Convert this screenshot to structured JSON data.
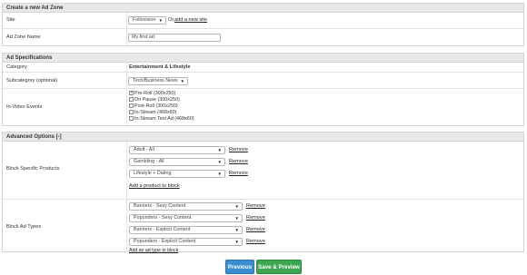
{
  "create": {
    "header": "Create a new Ad Zone",
    "site_label": "Site",
    "site_value": "Foliovision",
    "site_or": "Or,",
    "add_site_link": "add a new site",
    "zone_name_label": "Ad Zone Name",
    "zone_name_value": "My first ad"
  },
  "specs": {
    "header": "Ad Specifications",
    "category_label": "Category",
    "category_value": "Entertainment & Lifestyle",
    "subcategory_label": "Subcategory (optional)",
    "subcategory_value": "Tech/Business News",
    "events_label": "In-Video Events",
    "events": [
      {
        "label": "Pre-Roll (300x250)",
        "checked": true
      },
      {
        "label": "On Pause (300x250)",
        "checked": false
      },
      {
        "label": "Post-Roll (300x250)",
        "checked": false
      },
      {
        "label": "In-Stream (468x60)",
        "checked": false
      },
      {
        "label": "In-Stream Text Ad (468x60)",
        "checked": false
      }
    ]
  },
  "advanced": {
    "header": "Advanced Options [-]",
    "block_products_label": "Block Specific Products",
    "products": [
      "Adult - All",
      "Gambling - All",
      "Lifestyle + Dating"
    ],
    "remove_label": "Remove",
    "add_product_link": "Add a product to block",
    "block_types_label": "Block Ad Types",
    "types": [
      "Banners - Sexy Content",
      "Popunders - Sexy Content",
      "Banners - Explicit Content",
      "Popunders - Explicit Content"
    ],
    "add_type_link": "Add an ad type to block"
  },
  "buttons": {
    "previous": "Previous",
    "save_preview": "Save & Preview"
  },
  "colors": {
    "previous_bg": "#3a8ecf",
    "save_bg": "#3fa653",
    "header_bg": "#e8e8e8"
  }
}
